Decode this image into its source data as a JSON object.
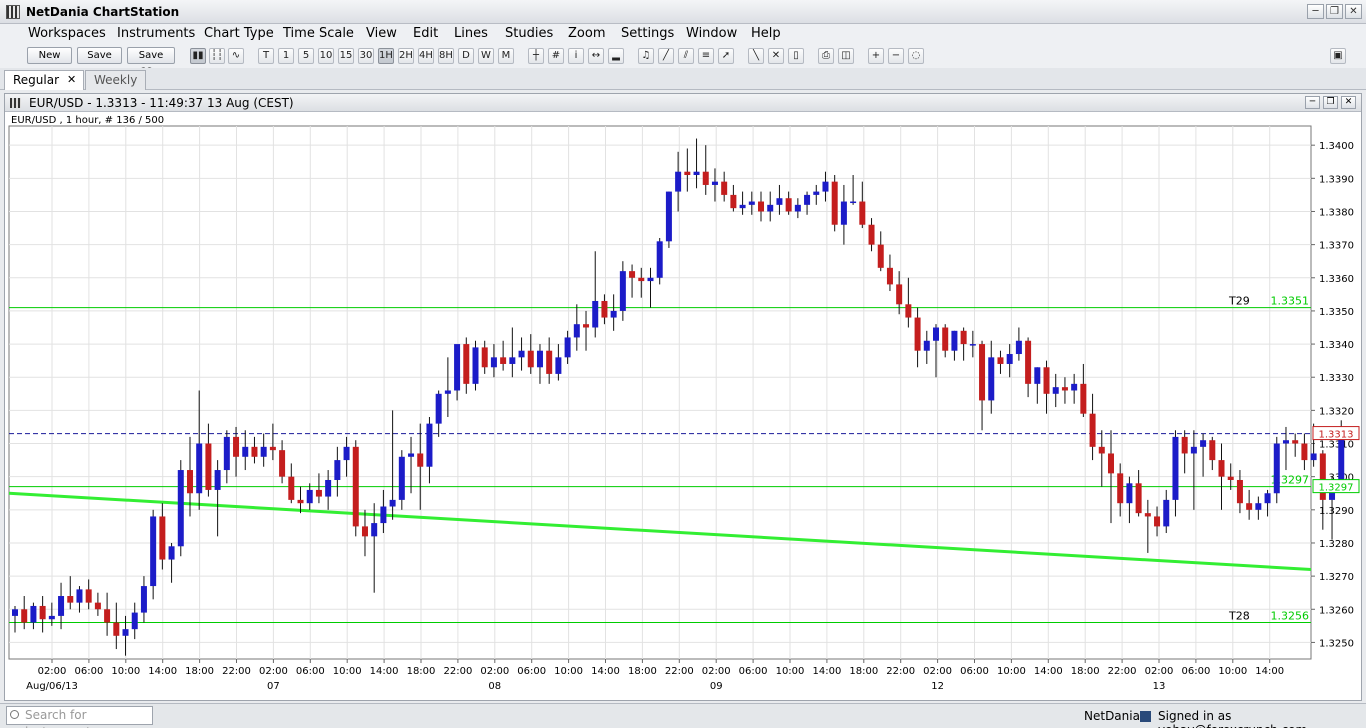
{
  "app": {
    "title": "NetDania ChartStation"
  },
  "menu": [
    "Workspaces",
    "Instruments",
    "Chart Type",
    "Time Scale",
    "View",
    "Edit",
    "Lines",
    "Studies",
    "Zoom",
    "Settings",
    "Window",
    "Help"
  ],
  "toolbar": {
    "new_label": "New",
    "save_label": "Save",
    "save_as_label": "Save as...",
    "timeframes": [
      "T",
      "1",
      "5",
      "10",
      "15",
      "30",
      "1H",
      "2H",
      "4H",
      "8H",
      "D",
      "W",
      "M"
    ],
    "active_timeframe": "1H"
  },
  "tabs": [
    {
      "label": "Regular",
      "close": "✕",
      "active": true
    },
    {
      "label": "Weekly",
      "active": false
    }
  ],
  "chart_window": {
    "title": "EUR/USD - 1.3313 - 11:49:37  13 Aug (CEST)",
    "subtitle": "EUR/USD , 1 hour, # 136 / 500"
  },
  "status": {
    "search_placeholder": "Search for instrument",
    "brand": "NetDania",
    "signed_in": "Signed in as yohay@forexcrunch.com"
  },
  "colors": {
    "up": "#1c1cc8",
    "down": "#c41e1e",
    "line": "#00cc00",
    "trend": "#33ee33",
    "current": "#1a1a9a"
  },
  "chart_data": {
    "type": "candlestick",
    "instrument": "EUR/USD",
    "interval": "1 hour",
    "ylim": [
      1.3245,
      1.3405
    ],
    "yticks": [
      1.325,
      1.326,
      1.327,
      1.328,
      1.329,
      1.33,
      1.331,
      1.332,
      1.333,
      1.334,
      1.335,
      1.336,
      1.337,
      1.338,
      1.339,
      1.34
    ],
    "time_labels": [
      "02:00",
      "06:00",
      "10:00",
      "14:00",
      "18:00",
      "22:00",
      "02:00",
      "06:00",
      "10:00",
      "14:00",
      "18:00",
      "22:00",
      "02:00",
      "06:00",
      "10:00",
      "14:00",
      "18:00",
      "22:00",
      "02:00",
      "06:00",
      "10:00",
      "14:00",
      "18:00",
      "22:00",
      "02:00",
      "06:00",
      "10:00",
      "14:00",
      "18:00",
      "22:00",
      "02:00",
      "06:00",
      "10:00",
      "14:00"
    ],
    "date_labels": [
      {
        "label": "Aug/06/13",
        "at": 0
      },
      {
        "label": "07",
        "at": 6
      },
      {
        "label": "08",
        "at": 12
      },
      {
        "label": "09",
        "at": 18
      },
      {
        "label": "12",
        "at": 24
      },
      {
        "label": "13",
        "at": 30
      }
    ],
    "current_price": 1.3313,
    "horizontal_lines": [
      {
        "label": "T29",
        "value": 1.3351
      },
      {
        "label": "T28",
        "value": 1.3256
      },
      {
        "label": "",
        "value": 1.3297
      }
    ],
    "trend_line": {
      "start": 1.3295,
      "end": 1.3272
    },
    "candles": [
      [
        1.3258,
        1.3261,
        1.3253,
        1.326
      ],
      [
        1.326,
        1.3264,
        1.3254,
        1.3256
      ],
      [
        1.3256,
        1.3262,
        1.3254,
        1.3261
      ],
      [
        1.3261,
        1.3264,
        1.3253,
        1.3257
      ],
      [
        1.3257,
        1.3262,
        1.3255,
        1.3258
      ],
      [
        1.3258,
        1.3268,
        1.3254,
        1.3264
      ],
      [
        1.3264,
        1.327,
        1.326,
        1.3262
      ],
      [
        1.3262,
        1.3267,
        1.3259,
        1.3266
      ],
      [
        1.3266,
        1.3269,
        1.326,
        1.3262
      ],
      [
        1.3262,
        1.3265,
        1.3258,
        1.326
      ],
      [
        1.326,
        1.3265,
        1.3252,
        1.3256
      ],
      [
        1.3256,
        1.3262,
        1.3248,
        1.3252
      ],
      [
        1.3252,
        1.3258,
        1.3246,
        1.3254
      ],
      [
        1.3254,
        1.3262,
        1.3251,
        1.3259
      ],
      [
        1.3259,
        1.327,
        1.3256,
        1.3267
      ],
      [
        1.3267,
        1.329,
        1.3263,
        1.3288
      ],
      [
        1.3288,
        1.3292,
        1.3272,
        1.3275
      ],
      [
        1.3275,
        1.328,
        1.3268,
        1.3279
      ],
      [
        1.3279,
        1.3305,
        1.3276,
        1.3302
      ],
      [
        1.3302,
        1.3312,
        1.3288,
        1.3295
      ],
      [
        1.3295,
        1.3326,
        1.329,
        1.331
      ],
      [
        1.331,
        1.3316,
        1.3294,
        1.3296
      ],
      [
        1.3296,
        1.3305,
        1.3282,
        1.3302
      ],
      [
        1.3302,
        1.3314,
        1.3298,
        1.3312
      ],
      [
        1.3312,
        1.3315,
        1.33,
        1.3306
      ],
      [
        1.3306,
        1.3314,
        1.3302,
        1.3309
      ],
      [
        1.3309,
        1.3312,
        1.3304,
        1.3306
      ],
      [
        1.3306,
        1.3313,
        1.3303,
        1.3309
      ],
      [
        1.3309,
        1.3316,
        1.3305,
        1.3308
      ],
      [
        1.3308,
        1.3311,
        1.3298,
        1.33
      ],
      [
        1.33,
        1.3304,
        1.3292,
        1.3293
      ],
      [
        1.3293,
        1.3297,
        1.3289,
        1.3292
      ],
      [
        1.3292,
        1.3298,
        1.329,
        1.3296
      ],
      [
        1.3296,
        1.3301,
        1.3292,
        1.3294
      ],
      [
        1.3294,
        1.3302,
        1.329,
        1.3299
      ],
      [
        1.3299,
        1.3309,
        1.3294,
        1.3305
      ],
      [
        1.3305,
        1.3312,
        1.33,
        1.3309
      ],
      [
        1.3309,
        1.3311,
        1.3282,
        1.3285
      ],
      [
        1.3285,
        1.329,
        1.3276,
        1.3282
      ],
      [
        1.3282,
        1.3292,
        1.3265,
        1.3286
      ],
      [
        1.3286,
        1.3296,
        1.3283,
        1.3291
      ],
      [
        1.3291,
        1.332,
        1.3287,
        1.3293
      ],
      [
        1.3293,
        1.3308,
        1.329,
        1.3306
      ],
      [
        1.3306,
        1.3312,
        1.3295,
        1.3307
      ],
      [
        1.3307,
        1.3316,
        1.329,
        1.3303
      ],
      [
        1.3303,
        1.3318,
        1.3298,
        1.3316
      ],
      [
        1.3316,
        1.3326,
        1.3312,
        1.3325
      ],
      [
        1.3325,
        1.3336,
        1.3318,
        1.3326
      ],
      [
        1.3326,
        1.3338,
        1.3323,
        1.334
      ],
      [
        1.334,
        1.3342,
        1.3325,
        1.3328
      ],
      [
        1.3328,
        1.3341,
        1.3326,
        1.3339
      ],
      [
        1.3339,
        1.3341,
        1.3331,
        1.3333
      ],
      [
        1.3333,
        1.334,
        1.333,
        1.3336
      ],
      [
        1.3336,
        1.3341,
        1.3332,
        1.3334
      ],
      [
        1.3334,
        1.3345,
        1.333,
        1.3336
      ],
      [
        1.3336,
        1.3342,
        1.3332,
        1.3338
      ],
      [
        1.3338,
        1.3343,
        1.3331,
        1.3333
      ],
      [
        1.3333,
        1.334,
        1.3328,
        1.3338
      ],
      [
        1.3338,
        1.3342,
        1.3328,
        1.3331
      ],
      [
        1.3331,
        1.334,
        1.3329,
        1.3336
      ],
      [
        1.3336,
        1.3344,
        1.3334,
        1.3342
      ],
      [
        1.3342,
        1.3352,
        1.3338,
        1.3346
      ],
      [
        1.3346,
        1.335,
        1.3338,
        1.3345
      ],
      [
        1.3345,
        1.3368,
        1.3342,
        1.3353
      ],
      [
        1.3353,
        1.3355,
        1.3346,
        1.3348
      ],
      [
        1.3348,
        1.3355,
        1.3344,
        1.335
      ],
      [
        1.335,
        1.3365,
        1.3347,
        1.3362
      ],
      [
        1.3362,
        1.3364,
        1.3354,
        1.336
      ],
      [
        1.336,
        1.3363,
        1.3354,
        1.3359
      ],
      [
        1.3359,
        1.3363,
        1.3351,
        1.336
      ],
      [
        1.336,
        1.3372,
        1.3358,
        1.3371
      ],
      [
        1.3371,
        1.3386,
        1.3369,
        1.3386
      ],
      [
        1.3386,
        1.3398,
        1.338,
        1.3392
      ],
      [
        1.3392,
        1.3399,
        1.3386,
        1.3391
      ],
      [
        1.3391,
        1.3402,
        1.3387,
        1.3392
      ],
      [
        1.3392,
        1.34,
        1.3385,
        1.3388
      ],
      [
        1.3388,
        1.3393,
        1.3383,
        1.3389
      ],
      [
        1.3389,
        1.3392,
        1.3383,
        1.3385
      ],
      [
        1.3385,
        1.3388,
        1.338,
        1.3381
      ],
      [
        1.3381,
        1.3386,
        1.3379,
        1.3382
      ],
      [
        1.3382,
        1.3386,
        1.3379,
        1.3383
      ],
      [
        1.3383,
        1.3386,
        1.3377,
        1.338
      ],
      [
        1.338,
        1.3386,
        1.3377,
        1.3382
      ],
      [
        1.3382,
        1.3388,
        1.3379,
        1.3384
      ],
      [
        1.3384,
        1.3386,
        1.3379,
        1.338
      ],
      [
        1.338,
        1.3384,
        1.3378,
        1.3382
      ],
      [
        1.3382,
        1.3386,
        1.3379,
        1.3385
      ],
      [
        1.3385,
        1.3388,
        1.3382,
        1.3386
      ],
      [
        1.3386,
        1.3392,
        1.3383,
        1.3389
      ],
      [
        1.3389,
        1.3391,
        1.3374,
        1.3376
      ],
      [
        1.3376,
        1.3388,
        1.337,
        1.3383
      ],
      [
        1.3383,
        1.3391,
        1.3382,
        1.3383
      ],
      [
        1.3383,
        1.3389,
        1.3375,
        1.3376
      ],
      [
        1.3376,
        1.3378,
        1.3368,
        1.337
      ],
      [
        1.337,
        1.3374,
        1.3362,
        1.3363
      ],
      [
        1.3363,
        1.3367,
        1.3356,
        1.3358
      ],
      [
        1.3358,
        1.3362,
        1.3349,
        1.3352
      ],
      [
        1.3352,
        1.336,
        1.3345,
        1.3348
      ],
      [
        1.3348,
        1.3351,
        1.3333,
        1.3338
      ],
      [
        1.3338,
        1.3344,
        1.3334,
        1.3341
      ],
      [
        1.3341,
        1.3346,
        1.333,
        1.3345
      ],
      [
        1.3345,
        1.3346,
        1.3336,
        1.3338
      ],
      [
        1.3338,
        1.3344,
        1.3335,
        1.3344
      ],
      [
        1.3344,
        1.3345,
        1.3335,
        1.334
      ],
      [
        1.334,
        1.3344,
        1.3336,
        1.334
      ],
      [
        1.334,
        1.3341,
        1.3314,
        1.3323
      ],
      [
        1.3323,
        1.3341,
        1.3319,
        1.3336
      ],
      [
        1.3336,
        1.3338,
        1.3331,
        1.3334
      ],
      [
        1.3334,
        1.334,
        1.333,
        1.3337
      ],
      [
        1.3337,
        1.3345,
        1.3335,
        1.3341
      ],
      [
        1.3341,
        1.3342,
        1.3324,
        1.3328
      ],
      [
        1.3328,
        1.3333,
        1.3322,
        1.3333
      ],
      [
        1.3333,
        1.3335,
        1.3319,
        1.3325
      ],
      [
        1.3325,
        1.3331,
        1.3321,
        1.3327
      ],
      [
        1.3327,
        1.333,
        1.3322,
        1.3326
      ],
      [
        1.3326,
        1.3331,
        1.3322,
        1.3328
      ],
      [
        1.3328,
        1.3334,
        1.3318,
        1.3319
      ],
      [
        1.3319,
        1.3325,
        1.3305,
        1.3309
      ],
      [
        1.3309,
        1.3314,
        1.3297,
        1.3307
      ],
      [
        1.3307,
        1.3314,
        1.3286,
        1.3301
      ],
      [
        1.3301,
        1.3304,
        1.3288,
        1.3292
      ],
      [
        1.3292,
        1.33,
        1.3286,
        1.3298
      ],
      [
        1.3298,
        1.3302,
        1.3288,
        1.3289
      ],
      [
        1.3289,
        1.3293,
        1.3277,
        1.3288
      ],
      [
        1.3288,
        1.3291,
        1.3282,
        1.3285
      ],
      [
        1.3285,
        1.3296,
        1.3283,
        1.3293
      ],
      [
        1.3293,
        1.3314,
        1.3288,
        1.3312
      ],
      [
        1.3312,
        1.3314,
        1.3301,
        1.3307
      ],
      [
        1.3307,
        1.3314,
        1.329,
        1.3309
      ],
      [
        1.3309,
        1.3313,
        1.33,
        1.3311
      ],
      [
        1.3311,
        1.3312,
        1.3302,
        1.3305
      ],
      [
        1.3305,
        1.331,
        1.329,
        1.33
      ],
      [
        1.33,
        1.3304,
        1.3296,
        1.3299
      ],
      [
        1.3299,
        1.3302,
        1.3289,
        1.3292
      ],
      [
        1.3292,
        1.3296,
        1.3287,
        1.329
      ],
      [
        1.329,
        1.3294,
        1.3287,
        1.3292
      ],
      [
        1.3292,
        1.3296,
        1.3288,
        1.3295
      ],
      [
        1.3295,
        1.3312,
        1.3292,
        1.331
      ],
      [
        1.331,
        1.3315,
        1.3302,
        1.3311
      ],
      [
        1.3311,
        1.3313,
        1.3306,
        1.331
      ],
      [
        1.331,
        1.3313,
        1.3302,
        1.3305
      ],
      [
        1.3305,
        1.3316,
        1.3303,
        1.3307
      ],
      [
        1.3307,
        1.3308,
        1.3284,
        1.3293
      ],
      [
        1.3293,
        1.33,
        1.3281,
        1.3298
      ],
      [
        1.3298,
        1.3317,
        1.3296,
        1.3313
      ]
    ]
  }
}
